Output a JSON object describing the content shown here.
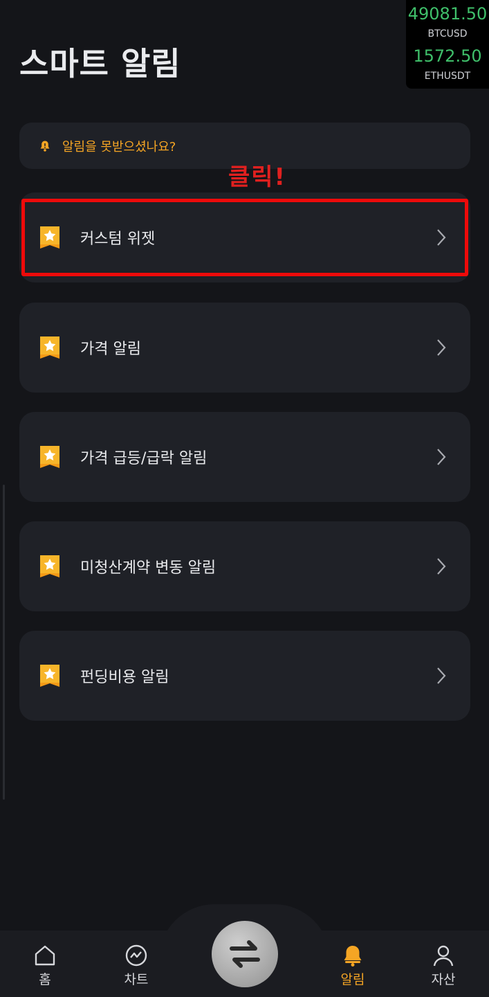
{
  "page": {
    "title": "스마트 알림"
  },
  "ticker": [
    {
      "price": "49081.50",
      "symbol": "BTCUSD"
    },
    {
      "price": "1572.50",
      "symbol": "ETHUSDT"
    }
  ],
  "notice": {
    "text": "알림을 못받으셨나요?",
    "icon": "bell-icon",
    "color": "#f5a524"
  },
  "annotation": {
    "text": "클릭!",
    "color": "#e0201f"
  },
  "alert_items": [
    {
      "label": "커스텀 위젯",
      "icon": "star-bookmark-icon"
    },
    {
      "label": "가격 알림",
      "icon": "star-bookmark-icon"
    },
    {
      "label": "가격 급등/급락 알림",
      "icon": "star-bookmark-icon"
    },
    {
      "label": "미청산계약 변동 알림",
      "icon": "star-bookmark-icon"
    },
    {
      "label": "펀딩비용 알림",
      "icon": "star-bookmark-icon"
    }
  ],
  "bottom_nav": [
    {
      "label": "홈",
      "icon": "home-icon"
    },
    {
      "label": "차트",
      "icon": "chart-icon"
    },
    {
      "label": "",
      "icon": "swap-icon"
    },
    {
      "label": "알림",
      "icon": "bell-icon",
      "active": true
    },
    {
      "label": "자산",
      "icon": "person-icon"
    }
  ],
  "colors": {
    "accent": "#f5a524",
    "price_up": "#3fbf6a",
    "background": "#141519",
    "card": "#1f2127"
  }
}
